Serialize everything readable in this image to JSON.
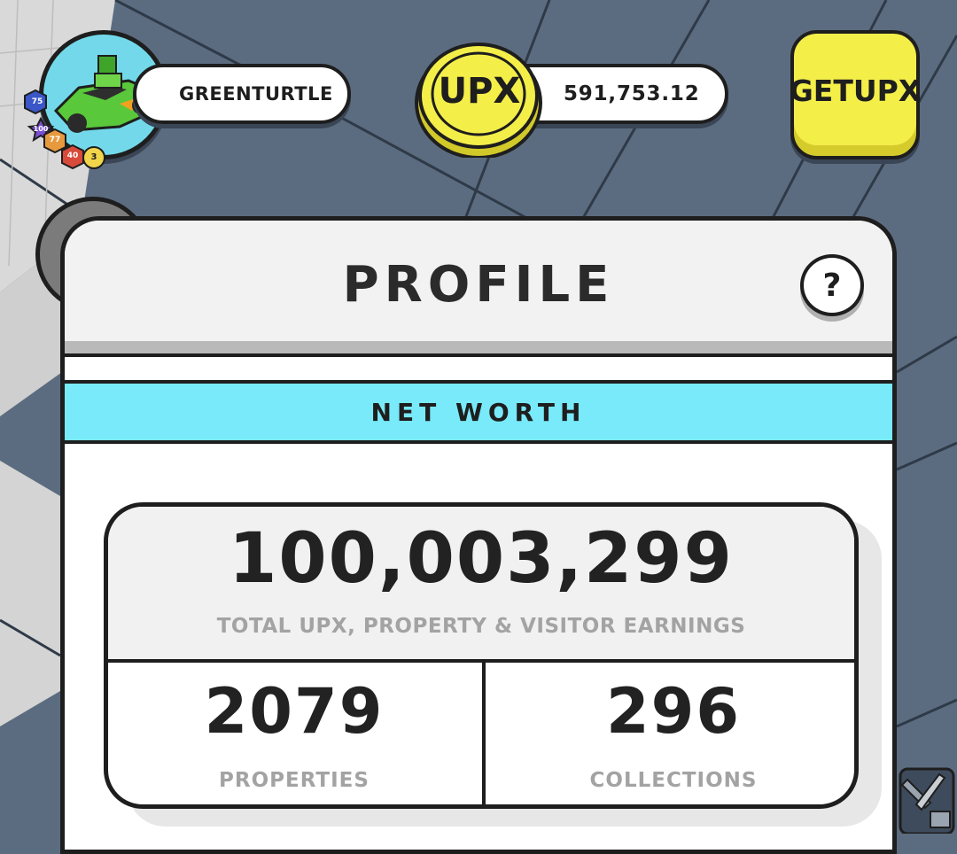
{
  "player": {
    "username": "GREENTURTLE",
    "badges": [
      {
        "value": "75",
        "color": "#3a56c8"
      },
      {
        "value": "100",
        "color": "#7a4fd3"
      },
      {
        "value": "77",
        "color": "#e79a3d"
      },
      {
        "value": "40",
        "color": "#d84a3a"
      },
      {
        "value": "3",
        "color": "#f1d54a"
      }
    ]
  },
  "wallet": {
    "currency": "UPX",
    "balance": "591,753.12",
    "get_button": "GET UPX"
  },
  "profile": {
    "title": "PROFILE",
    "help": "?",
    "section": "NET WORTH",
    "total_value": "100,003,299",
    "total_label": "TOTAL UPX, PROPERTY & VISITOR EARNINGS",
    "properties_value": "2079",
    "properties_label": "PROPERTIES",
    "collections_value": "296",
    "collections_label": "COLLECTIONS"
  },
  "colors": {
    "map_background": "#5c6c80",
    "net_worth_bar": "#78eafa",
    "get_upx_button": "#f4ee49",
    "coin": "#f4ee49"
  }
}
